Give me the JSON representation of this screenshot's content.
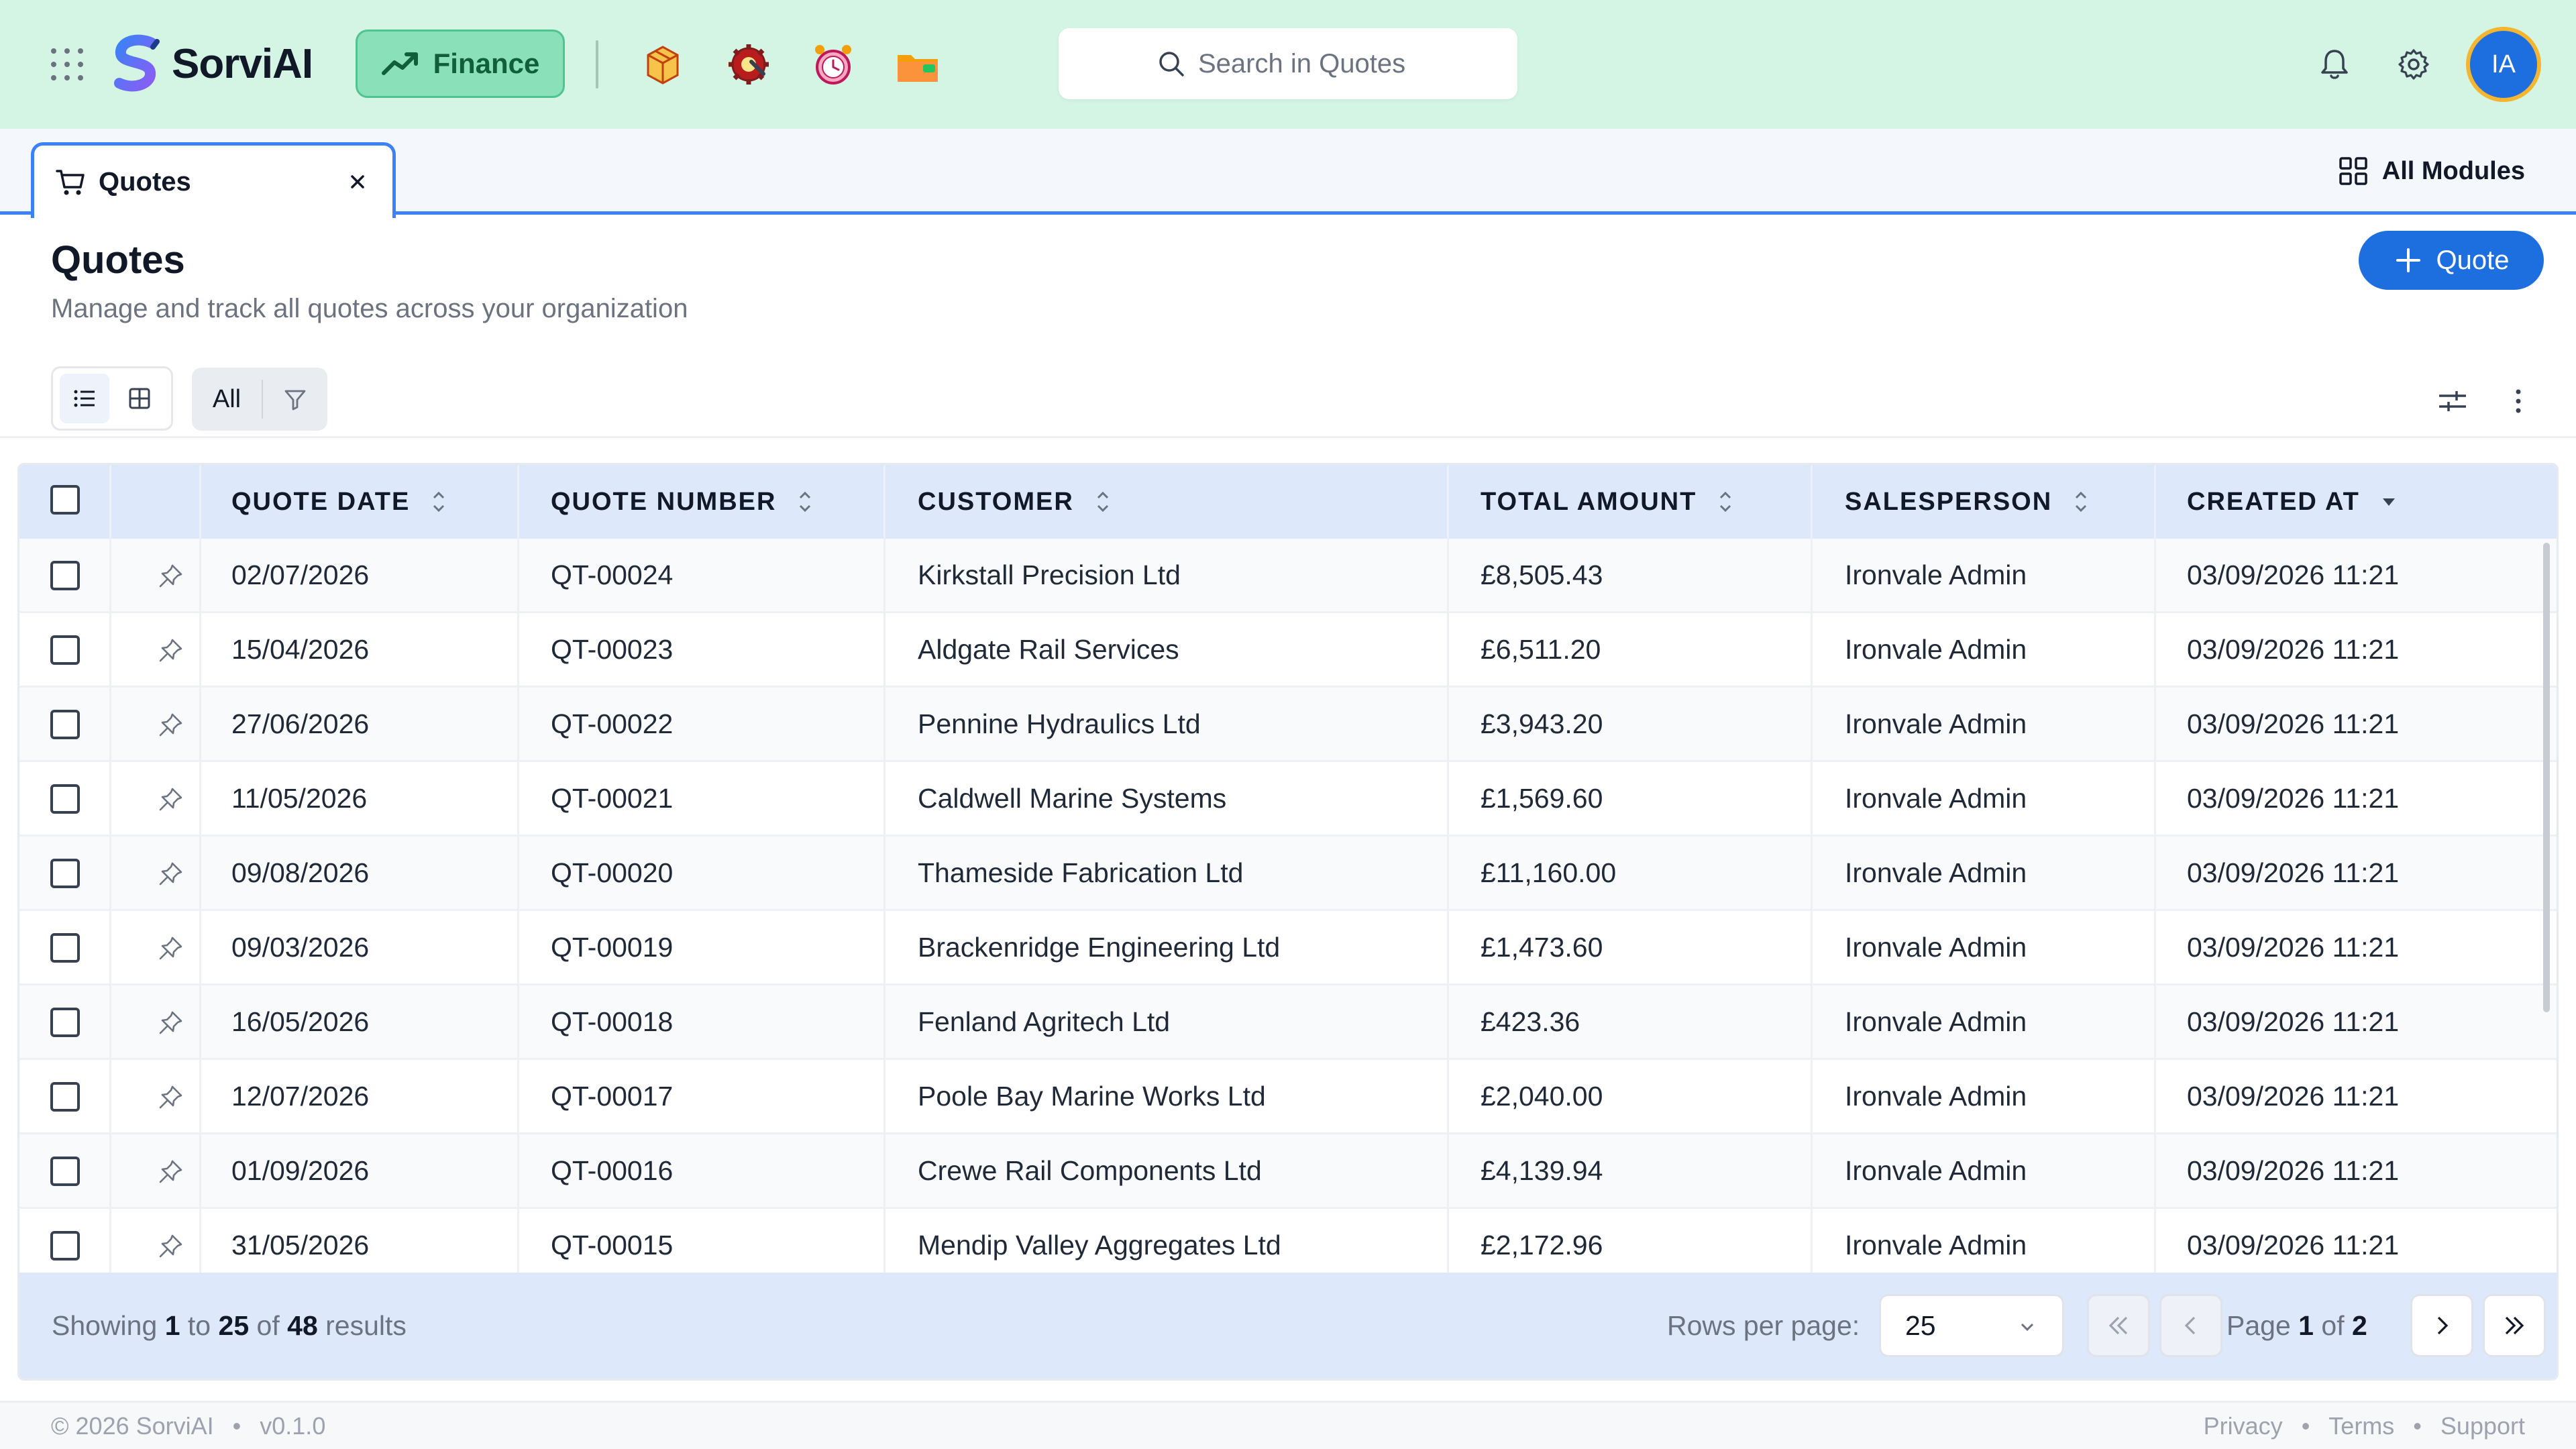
{
  "app": {
    "brand": "SorviAI",
    "module": "Finance",
    "colors": {
      "header_bg": "#d4f5e4",
      "accent": "#1d6fe0",
      "module_pill": "#8ae0b8"
    }
  },
  "header": {
    "search_placeholder": "Search in Quotes",
    "module_icons": [
      "package-icon",
      "gear-wrench-icon",
      "alarm-clock-icon",
      "folder-icon"
    ],
    "avatar_initials": "IA"
  },
  "tabs": {
    "active_label": "Quotes",
    "all_modules_label": "All Modules"
  },
  "page": {
    "title": "Quotes",
    "subtitle": "Manage and track all quotes across your organization",
    "add_button": "Quote"
  },
  "toolbar": {
    "filter_label": "All"
  },
  "table": {
    "columns": [
      "QUOTE DATE",
      "QUOTE NUMBER",
      "CUSTOMER",
      "TOTAL AMOUNT",
      "SALESPERSON",
      "CREATED AT"
    ],
    "sorted_column": "CREATED AT",
    "sort_direction": "desc",
    "rows": [
      {
        "quote_date": "02/07/2026",
        "quote_number": "QT-00024",
        "customer": "Kirkstall Precision Ltd",
        "total": "£8,505.43",
        "salesperson": "Ironvale Admin",
        "created_at": "03/09/2026 11:21"
      },
      {
        "quote_date": "15/04/2026",
        "quote_number": "QT-00023",
        "customer": "Aldgate Rail Services",
        "total": "£6,511.20",
        "salesperson": "Ironvale Admin",
        "created_at": "03/09/2026 11:21"
      },
      {
        "quote_date": "27/06/2026",
        "quote_number": "QT-00022",
        "customer": "Pennine Hydraulics Ltd",
        "total": "£3,943.20",
        "salesperson": "Ironvale Admin",
        "created_at": "03/09/2026 11:21"
      },
      {
        "quote_date": "11/05/2026",
        "quote_number": "QT-00021",
        "customer": "Caldwell Marine Systems",
        "total": "£1,569.60",
        "salesperson": "Ironvale Admin",
        "created_at": "03/09/2026 11:21"
      },
      {
        "quote_date": "09/08/2026",
        "quote_number": "QT-00020",
        "customer": "Thameside Fabrication Ltd",
        "total": "£11,160.00",
        "salesperson": "Ironvale Admin",
        "created_at": "03/09/2026 11:21"
      },
      {
        "quote_date": "09/03/2026",
        "quote_number": "QT-00019",
        "customer": "Brackenridge Engineering Ltd",
        "total": "£1,473.60",
        "salesperson": "Ironvale Admin",
        "created_at": "03/09/2026 11:21"
      },
      {
        "quote_date": "16/05/2026",
        "quote_number": "QT-00018",
        "customer": "Fenland Agritech Ltd",
        "total": "£423.36",
        "salesperson": "Ironvale Admin",
        "created_at": "03/09/2026 11:21"
      },
      {
        "quote_date": "12/07/2026",
        "quote_number": "QT-00017",
        "customer": "Poole Bay Marine Works Ltd",
        "total": "£2,040.00",
        "salesperson": "Ironvale Admin",
        "created_at": "03/09/2026 11:21"
      },
      {
        "quote_date": "01/09/2026",
        "quote_number": "QT-00016",
        "customer": "Crewe Rail Components Ltd",
        "total": "£4,139.94",
        "salesperson": "Ironvale Admin",
        "created_at": "03/09/2026 11:21"
      },
      {
        "quote_date": "31/05/2026",
        "quote_number": "QT-00015",
        "customer": "Mendip Valley Aggregates Ltd",
        "total": "£2,172.96",
        "salesperson": "Ironvale Admin",
        "created_at": "03/09/2026 11:21"
      }
    ]
  },
  "pagination": {
    "showing_prefix": "Showing",
    "from": "1",
    "to_word": "to",
    "to": "25",
    "of_word": "of",
    "total": "48",
    "results_word": "results",
    "rows_per_page_label": "Rows per page:",
    "rows_per_page": "25",
    "page_word": "Page",
    "current_page": "1",
    "total_pages": "2"
  },
  "footer": {
    "copyright": "© 2026 SorviAI",
    "version": "v0.1.0",
    "links": [
      "Privacy",
      "Terms",
      "Support"
    ]
  }
}
